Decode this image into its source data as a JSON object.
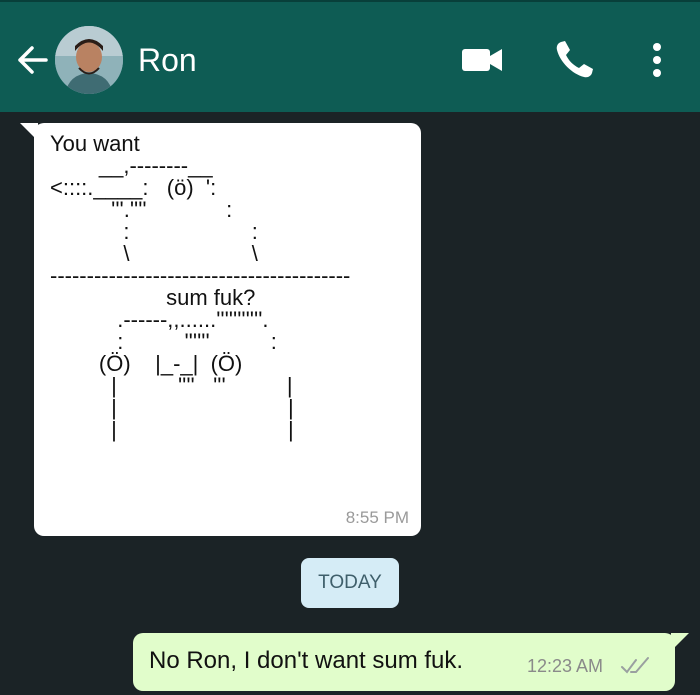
{
  "header": {
    "contact_name": "Ron"
  },
  "icons": {
    "back": "arrow-left-icon",
    "video": "video-camera-icon",
    "call": "phone-icon",
    "menu": "more-vert-icon"
  },
  "messages": [
    {
      "direction": "in",
      "text": "You want\n        __,--------__\n<::::.____:   (ö)  ':\n          '''.''''             :\n            :                    :\n            \\                    \\\n-----------------------------------------\n                   sum fuk?\n           .------,,......'''''''''''.\n           :          ''''''          :\n        (Ö)    |_-_|  (Ö)\n          |          ''''   '''          |\n          |                            |\n          |                            |",
      "time": "8:55 PM"
    },
    {
      "direction": "out",
      "text": "No Ron, I don't want sum fuk.",
      "time": "12:23 AM"
    }
  ],
  "date_separator": "TODAY",
  "colors": {
    "header": "#0e5c54",
    "background": "#1b2326",
    "incoming_bubble": "#ffffff",
    "outgoing_bubble": "#e1fdcb",
    "date_chip": "#d5ecf6"
  }
}
